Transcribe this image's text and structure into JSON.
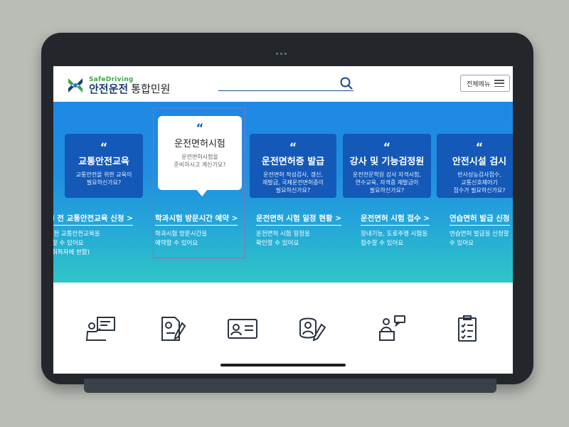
{
  "logo": {
    "sub": "SafeDriving",
    "main": "안전운전",
    "main2": "통합민원"
  },
  "header": {
    "menu_label": "전체메뉴"
  },
  "cards": [
    {
      "title": "교통안전교육",
      "desc": "교통안전을 위한 교육이\n필요하신가요?"
    },
    {
      "title": "운전면허시험",
      "desc": "운전면허시험을\n준비하시고 계신가요?"
    },
    {
      "title": "운전면허증 발급",
      "desc": "운전면허 적성검사, 갱신,\n재발급, 국제운전면허증이\n필요하신가요?"
    },
    {
      "title": "강사 및 기능검정원",
      "desc": "운전전문학원 강사 자격시험,\n연수교육, 자격증 재발급이\n필요하신가요?"
    },
    {
      "title": "안전시설 검시",
      "desc": "반사성능검사접수,\n교통신호제어기\n접수가 필요하신가요?"
    }
  ],
  "quote_mark": "“",
  "links": [
    {
      "label": "l 전 교통안전교육 신청 >",
      "desc": "l전 교통안전교육을\n할 수 있어요\n취득자에 한함)"
    },
    {
      "label": "학과시험 방문시간 예약 >",
      "desc": "학과시험 방문시간을\n예약할 수 있어요"
    },
    {
      "label": "운전면허 시험 일정 현황 >",
      "desc": "운전면허 시험 일정을\n확인할 수 있어요"
    },
    {
      "label": "운전면허 시험 접수 >",
      "desc": "장내기능, 도로주행 시험을\n접수할 수 있어요"
    },
    {
      "label": "연습면허 발급 신청",
      "desc": "연습면허 발급을 신청할\n수 있어요"
    }
  ],
  "icons": [
    "lecture-icon",
    "document-edit-icon",
    "license-card-icon",
    "consult-edit-icon",
    "instructor-podium-icon",
    "checklist-icon"
  ],
  "colors": {
    "brand_blue": "#1459b8",
    "brand_green": "#3aa64a",
    "hero_top": "#1e88e5",
    "hero_bottom": "#2fc6c6",
    "highlight": "#c9569a"
  }
}
